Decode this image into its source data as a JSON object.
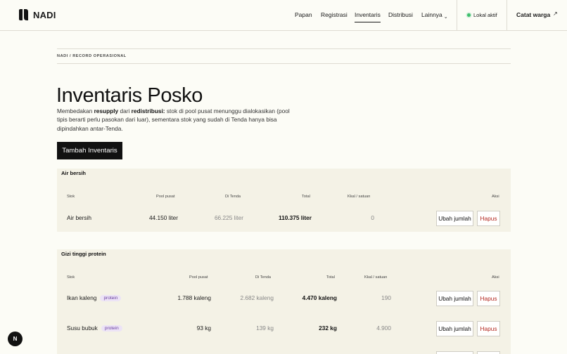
{
  "app": {
    "name": "NADI"
  },
  "nav": {
    "items": [
      "Papan",
      "Registrasi",
      "Inventaris",
      "Distribusi",
      "Lainnya"
    ],
    "active": "Inventaris"
  },
  "status": {
    "label": "Lokal aktif",
    "color": "#3fbf6c"
  },
  "cta": {
    "label": "Catat warga"
  },
  "breadcrumb": "NADI / RECORD OPERASIONAL",
  "page": {
    "title": "Inventaris Posko",
    "desc_1": "Membedakan ",
    "desc_resupply": "resupply",
    "desc_2": " dari ",
    "desc_redis": "redistribusi:",
    "desc_3": " stok di pool pusat menunggu dialokasikan (pool tipis berarti perlu pasokan dari luar), sementara stok yang sudah di Tenda hanya bisa dipindahkan antar-Tenda.",
    "add_button": "Tambah Inventaris"
  },
  "columns": {
    "stok": "Stok",
    "pool": "Pool pusat",
    "tenda": "Di Tenda",
    "total": "Total",
    "kkal": "Kkal / satuan",
    "aksi": "Aksi"
  },
  "actions": {
    "edit": "Ubah jumlah",
    "delete": "Hapus"
  },
  "sections": [
    {
      "title": "Air bersih",
      "rows": [
        {
          "name": "Air bersih",
          "tag": "",
          "pool": "44.150 liter",
          "tenda": "66.225 liter",
          "total": "110.375 liter",
          "kkal": "0"
        }
      ]
    },
    {
      "title": "Gizi tinggi protein",
      "rows": [
        {
          "name": "Ikan kaleng",
          "tag": "protein",
          "pool": "1.788 kaleng",
          "tenda": "2.682 kaleng",
          "total": "4.470 kaleng",
          "kkal": "190"
        },
        {
          "name": "Susu bubuk",
          "tag": "protein",
          "pool": "93 kg",
          "tenda": "139 kg",
          "total": "232 kg",
          "kkal": "4.900"
        }
      ]
    }
  ],
  "fab": {
    "label": "N"
  }
}
